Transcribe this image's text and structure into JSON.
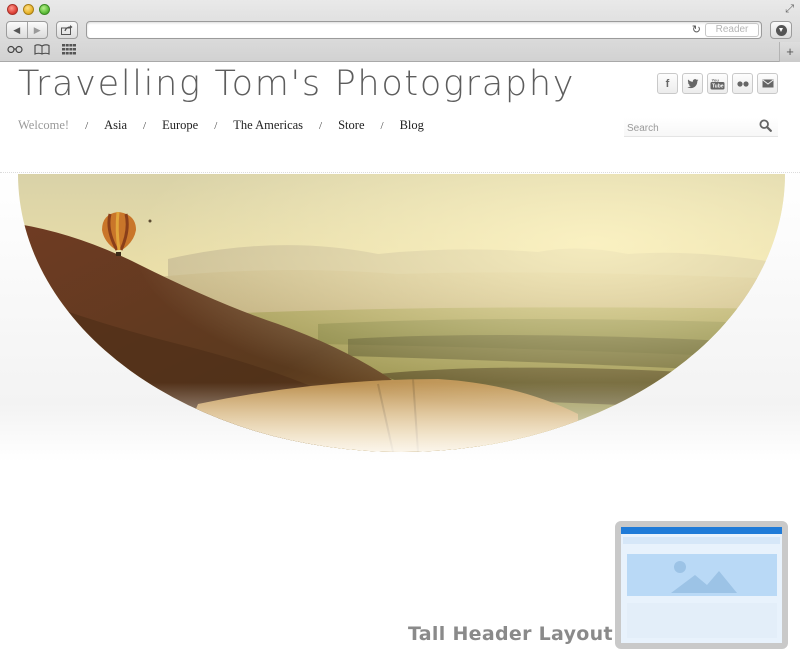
{
  "browser": {
    "reader_label": "Reader",
    "icons": {
      "back": "back-arrow-icon",
      "forward": "forward-arrow-icon",
      "share": "share-icon",
      "reload": "reload-icon",
      "downloads": "downloads-icon",
      "reading_list": "glasses-icon",
      "bookmarks": "open-book-icon",
      "top_sites": "grid-icon",
      "new_tab": "plus-icon"
    }
  },
  "site": {
    "title": "Travelling Tom's Photography",
    "social": [
      "facebook",
      "twitter",
      "youtube",
      "flickr",
      "email"
    ],
    "social_glyphs": [
      "f",
      "t",
      "You",
      "••",
      "✉"
    ],
    "nav": [
      {
        "label": "Welcome!",
        "active": true
      },
      {
        "label": "Asia"
      },
      {
        "label": "Europe"
      },
      {
        "label": "The Americas"
      },
      {
        "label": "Store"
      },
      {
        "label": "Blog"
      }
    ],
    "nav_separator": "/",
    "search_placeholder": "Search",
    "hero_alt": "hot air balloon over hills and valley at sunrise"
  },
  "overlay": {
    "layout_label": "Tall Header Layout",
    "thumb_header_color": "#1f7bd8",
    "thumb_image_color": "#b9d9f6"
  },
  "colors": {
    "title": "#5d5d5d",
    "nav_active": "#9a9a9a"
  }
}
